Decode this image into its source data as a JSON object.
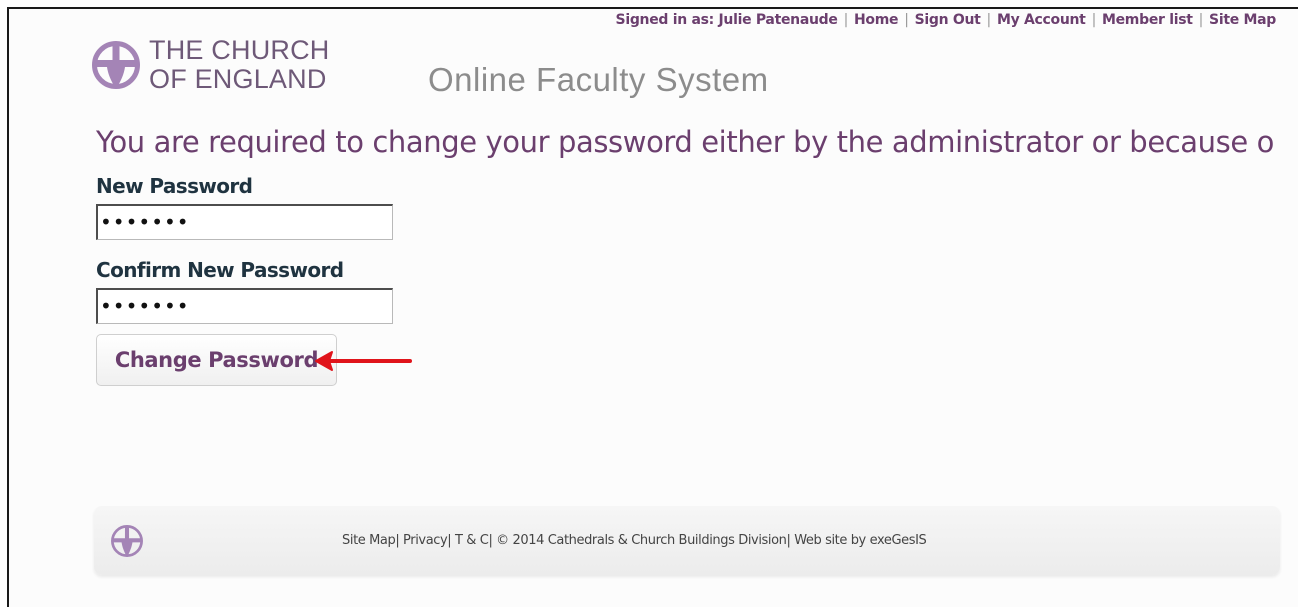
{
  "topnav": {
    "signed_in": "Signed in as: Julie Patenaude",
    "links": [
      "Home",
      "Sign Out",
      "My Account",
      "Member list",
      "Site Map"
    ]
  },
  "logo": {
    "line1": "THE CHURCH",
    "line2": "OF ENGLAND"
  },
  "app_title": "Online Faculty System",
  "heading": "You are required to change your password either by the administrator or because o",
  "form": {
    "new_password_label": "New Password",
    "new_password_value": "•••••••",
    "confirm_password_label": "Confirm New Password",
    "confirm_password_value": "•••••••",
    "submit_label": "Change Password"
  },
  "footer": {
    "text": "Site Map| Privacy| T & C| © 2014 Cathedrals & Church Buildings Division| Web site by exeGesIS"
  },
  "colors": {
    "brand_purple": "#6b3f6e",
    "logo_purple": "#a484b6",
    "arrow_red": "#e0141b"
  },
  "icons": {
    "logo": "church-of-england-cross-icon",
    "annotation": "red-arrow-icon"
  }
}
